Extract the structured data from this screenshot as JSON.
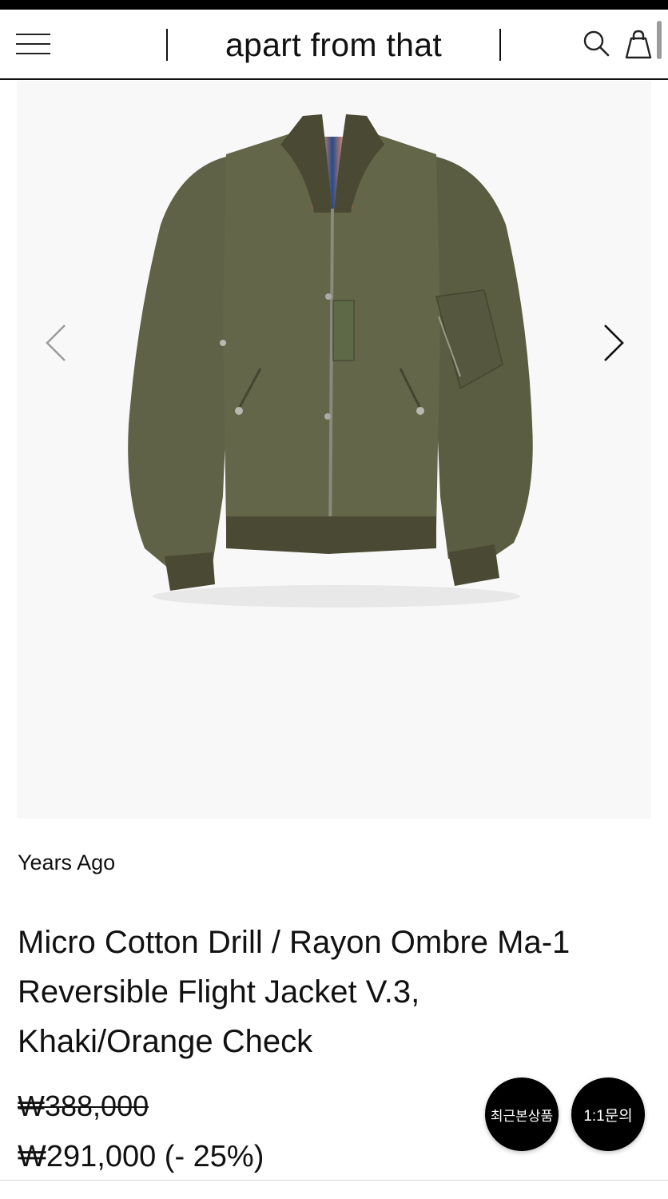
{
  "header": {
    "brand": "apart from that",
    "icons": {
      "menu": "menu-icon",
      "search": "search-icon",
      "cart": "shopping-bag-icon"
    }
  },
  "gallery": {
    "image_alt": "Khaki reversible MA-1 flight jacket",
    "prev_icon": "chevron-left-icon",
    "next_icon": "chevron-right-icon"
  },
  "product": {
    "brand": "Years Ago",
    "title_lines": [
      "Micro Cotton Drill / Rayon Ombre Ma-1",
      "Reversible Flight Jacket V.3,",
      "Khaki/Orange Check"
    ],
    "price_original": "₩388,000",
    "price_sale": "₩291,000 (- 25%)"
  },
  "floating_buttons": {
    "recent": "최근본상품",
    "inquiry": "1:1문의"
  },
  "colors": {
    "jacket": "#5f6246",
    "jacket_shadow": "#4a4c36",
    "rib": "#4a4a34",
    "lining_orange": "#c8643c",
    "lining_blue": "#2a4a8a",
    "background": "#f8f8f8"
  }
}
